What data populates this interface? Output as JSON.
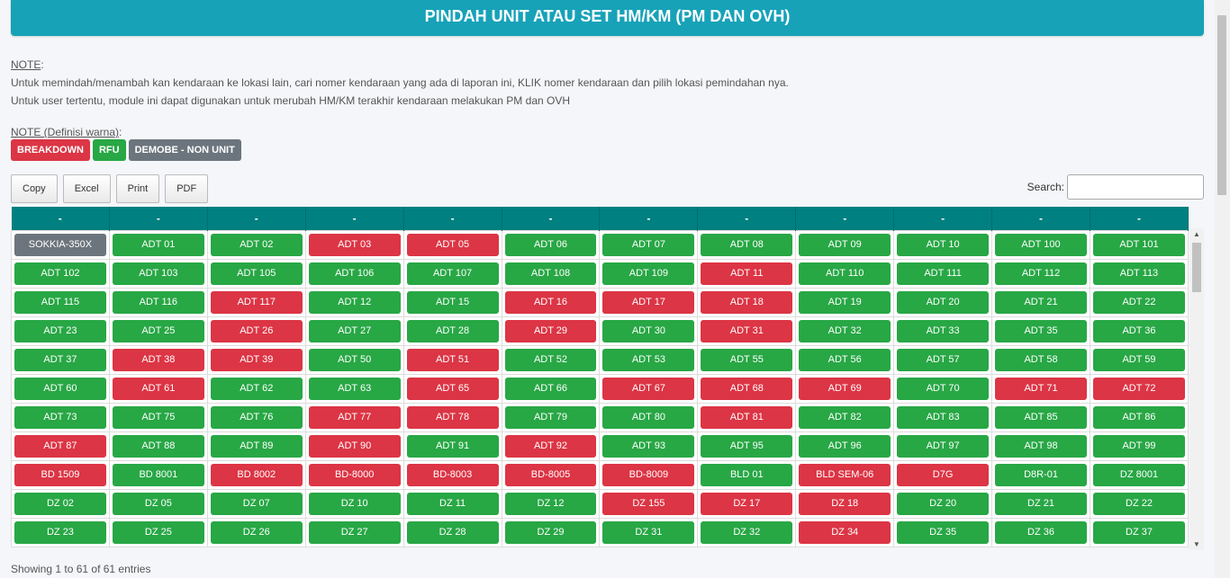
{
  "header": {
    "title": "PINDAH UNIT ATAU SET HM/KM (PM DAN OVH)"
  },
  "notes": {
    "label": "NOTE",
    "line1": "Untuk memindah/menambah kan kendaraan ke lokasi lain, cari nomer kendaraan yang ada di laporan ini, KLIK nomer kendaraan dan pilih lokasi pemindahan nya.",
    "line2": "Untuk user tertentu, module ini dapat digunakan untuk merubah HM/KM terakhir kendaraan melakukan PM dan OVH"
  },
  "legend": {
    "label": "NOTE (Definisi warna)",
    "breakdown": "BREAKDOWN",
    "rfu": "RFU",
    "demobe": "DEMOBE - NON UNIT"
  },
  "toolbar": {
    "copy": "Copy",
    "excel": "Excel",
    "print": "Print",
    "pdf": "PDF"
  },
  "search": {
    "label": "Search:",
    "value": "",
    "placeholder": ""
  },
  "colors": {
    "breakdown": "#dc3545",
    "rfu": "#28a745",
    "demobe": "#6c757d",
    "header_bg": "#17a2b8",
    "table_header": "#008080"
  },
  "table": {
    "headers": [
      "-",
      "-",
      "-",
      "-",
      "-",
      "-",
      "-",
      "-",
      "-",
      "-",
      "-",
      "-"
    ],
    "rows": [
      [
        [
          "SOKKIA-350X",
          "d"
        ],
        [
          "ADT 01",
          "g"
        ],
        [
          "ADT 02",
          "g"
        ],
        [
          "ADT 03",
          "r"
        ],
        [
          "ADT 05",
          "r"
        ],
        [
          "ADT 06",
          "g"
        ],
        [
          "ADT 07",
          "g"
        ],
        [
          "ADT 08",
          "g"
        ],
        [
          "ADT 09",
          "g"
        ],
        [
          "ADT 10",
          "g"
        ],
        [
          "ADT 100",
          "g"
        ],
        [
          "ADT 101",
          "g"
        ]
      ],
      [
        [
          "ADT 102",
          "g"
        ],
        [
          "ADT 103",
          "g"
        ],
        [
          "ADT 105",
          "g"
        ],
        [
          "ADT 106",
          "g"
        ],
        [
          "ADT 107",
          "g"
        ],
        [
          "ADT 108",
          "g"
        ],
        [
          "ADT 109",
          "g"
        ],
        [
          "ADT 11",
          "r"
        ],
        [
          "ADT 110",
          "g"
        ],
        [
          "ADT 111",
          "g"
        ],
        [
          "ADT 112",
          "g"
        ],
        [
          "ADT 113",
          "g"
        ]
      ],
      [
        [
          "ADT 115",
          "g"
        ],
        [
          "ADT 116",
          "g"
        ],
        [
          "ADT 117",
          "r"
        ],
        [
          "ADT 12",
          "g"
        ],
        [
          "ADT 15",
          "g"
        ],
        [
          "ADT 16",
          "r"
        ],
        [
          "ADT 17",
          "r"
        ],
        [
          "ADT 18",
          "r"
        ],
        [
          "ADT 19",
          "g"
        ],
        [
          "ADT 20",
          "g"
        ],
        [
          "ADT 21",
          "g"
        ],
        [
          "ADT 22",
          "g"
        ]
      ],
      [
        [
          "ADT 23",
          "g"
        ],
        [
          "ADT 25",
          "g"
        ],
        [
          "ADT 26",
          "r"
        ],
        [
          "ADT 27",
          "g"
        ],
        [
          "ADT 28",
          "g"
        ],
        [
          "ADT 29",
          "r"
        ],
        [
          "ADT 30",
          "g"
        ],
        [
          "ADT 31",
          "r"
        ],
        [
          "ADT 32",
          "g"
        ],
        [
          "ADT 33",
          "g"
        ],
        [
          "ADT 35",
          "g"
        ],
        [
          "ADT 36",
          "g"
        ]
      ],
      [
        [
          "ADT 37",
          "g"
        ],
        [
          "ADT 38",
          "r"
        ],
        [
          "ADT 39",
          "r"
        ],
        [
          "ADT 50",
          "g"
        ],
        [
          "ADT 51",
          "r"
        ],
        [
          "ADT 52",
          "g"
        ],
        [
          "ADT 53",
          "g"
        ],
        [
          "ADT 55",
          "g"
        ],
        [
          "ADT 56",
          "g"
        ],
        [
          "ADT 57",
          "g"
        ],
        [
          "ADT 58",
          "g"
        ],
        [
          "ADT 59",
          "g"
        ]
      ],
      [
        [
          "ADT 60",
          "g"
        ],
        [
          "ADT 61",
          "r"
        ],
        [
          "ADT 62",
          "g"
        ],
        [
          "ADT 63",
          "g"
        ],
        [
          "ADT 65",
          "r"
        ],
        [
          "ADT 66",
          "g"
        ],
        [
          "ADT 67",
          "r"
        ],
        [
          "ADT 68",
          "r"
        ],
        [
          "ADT 69",
          "r"
        ],
        [
          "ADT 70",
          "g"
        ],
        [
          "ADT 71",
          "r"
        ],
        [
          "ADT 72",
          "r"
        ]
      ],
      [
        [
          "ADT 73",
          "g"
        ],
        [
          "ADT 75",
          "g"
        ],
        [
          "ADT 76",
          "g"
        ],
        [
          "ADT 77",
          "r"
        ],
        [
          "ADT 78",
          "r"
        ],
        [
          "ADT 79",
          "g"
        ],
        [
          "ADT 80",
          "g"
        ],
        [
          "ADT 81",
          "r"
        ],
        [
          "ADT 82",
          "g"
        ],
        [
          "ADT 83",
          "g"
        ],
        [
          "ADT 85",
          "g"
        ],
        [
          "ADT 86",
          "g"
        ]
      ],
      [
        [
          "ADT 87",
          "r"
        ],
        [
          "ADT 88",
          "g"
        ],
        [
          "ADT 89",
          "g"
        ],
        [
          "ADT 90",
          "r"
        ],
        [
          "ADT 91",
          "g"
        ],
        [
          "ADT 92",
          "r"
        ],
        [
          "ADT 93",
          "g"
        ],
        [
          "ADT 95",
          "g"
        ],
        [
          "ADT 96",
          "g"
        ],
        [
          "ADT 97",
          "g"
        ],
        [
          "ADT 98",
          "g"
        ],
        [
          "ADT 99",
          "g"
        ]
      ],
      [
        [
          "BD 1509",
          "r"
        ],
        [
          "BD 8001",
          "g"
        ],
        [
          "BD 8002",
          "r"
        ],
        [
          "BD-8000",
          "r"
        ],
        [
          "BD-8003",
          "r"
        ],
        [
          "BD-8005",
          "r"
        ],
        [
          "BD-8009",
          "r"
        ],
        [
          "BLD 01",
          "g"
        ],
        [
          "BLD SEM-06",
          "r"
        ],
        [
          "D7G",
          "r"
        ],
        [
          "D8R-01",
          "g"
        ],
        [
          "DZ 8001",
          "g"
        ]
      ],
      [
        [
          "DZ 02",
          "g"
        ],
        [
          "DZ 05",
          "g"
        ],
        [
          "DZ 07",
          "g"
        ],
        [
          "DZ 10",
          "g"
        ],
        [
          "DZ 11",
          "g"
        ],
        [
          "DZ 12",
          "g"
        ],
        [
          "DZ 155",
          "r"
        ],
        [
          "DZ 17",
          "r"
        ],
        [
          "DZ 18",
          "r"
        ],
        [
          "DZ 20",
          "g"
        ],
        [
          "DZ 21",
          "g"
        ],
        [
          "DZ 22",
          "g"
        ]
      ],
      [
        [
          "DZ 23",
          "g"
        ],
        [
          "DZ 25",
          "g"
        ],
        [
          "DZ 26",
          "g"
        ],
        [
          "DZ 27",
          "g"
        ],
        [
          "DZ 28",
          "g"
        ],
        [
          "DZ 29",
          "g"
        ],
        [
          "DZ 31",
          "g"
        ],
        [
          "DZ 32",
          "g"
        ],
        [
          "DZ 34",
          "r"
        ],
        [
          "DZ 35",
          "g"
        ],
        [
          "DZ 36",
          "g"
        ],
        [
          "DZ 37",
          "g"
        ]
      ]
    ]
  },
  "info": "Showing 1 to 61 of 61 entries"
}
